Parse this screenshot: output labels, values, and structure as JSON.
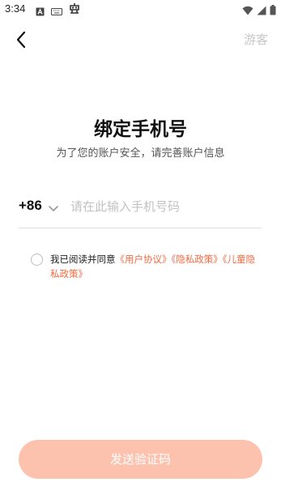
{
  "status_bar": {
    "time": "3:34",
    "left_icons": [
      "app-a-icon",
      "keyboard-icon",
      "robot-icon"
    ],
    "right_icons": [
      "wifi-icon",
      "signal-icon",
      "battery-icon"
    ]
  },
  "header": {
    "back_icon": "chevron-left-icon",
    "guest_label": "游客"
  },
  "main": {
    "title": "绑定手机号",
    "subtitle": "为了您的账户安全，请完善账户信息"
  },
  "phone": {
    "country_code": "+86",
    "placeholder": "请在此输入手机号码",
    "value": ""
  },
  "agreement": {
    "checked": false,
    "prefix": "我已阅读并同意",
    "links": [
      "《用户协议》",
      "《隐私政策》",
      "《儿童隐私政策》"
    ]
  },
  "footer": {
    "send_label": "发送验证码"
  },
  "colors": {
    "accent": "#f06a40",
    "button_disabled": "#fdc2ae"
  }
}
